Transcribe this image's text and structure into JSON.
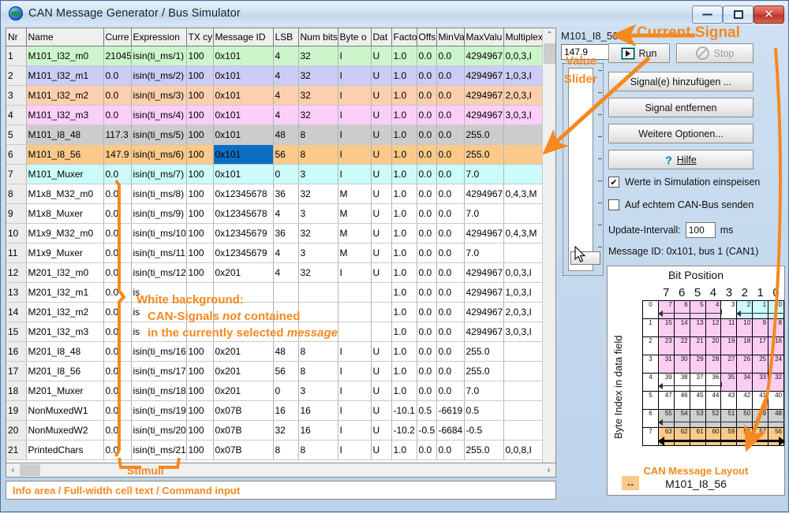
{
  "window": {
    "title": "CAN Message Generator / Bus Simulator",
    "icon": "globe-icon",
    "minimize_label": "–",
    "maximize_label": "□",
    "close_label": "✕"
  },
  "grid": {
    "columns": [
      "Nr",
      "Name",
      "Curre",
      "Expression",
      "TX cy",
      "Message ID",
      "LSB",
      "Num bits",
      "Byte o",
      "Dat",
      "Facto",
      "Offs",
      "MinVa",
      "MaxValu",
      "Multiplex"
    ],
    "selected_cell": {
      "row": 6,
      "column": "Message ID",
      "value": "0x101"
    },
    "rows": [
      {
        "nr": "1",
        "name": "M101_I32_m0",
        "cur": "21045",
        "expr": "isin(ti_ms/1)",
        "tx": "100",
        "msg": "0x101",
        "lsb": "4",
        "nbits": "32",
        "byteo": "I",
        "dt": "U",
        "factor": "1.0",
        "offset": "0.0",
        "minv": "0.0",
        "maxv": "4294967",
        "mux": "0,0,3,I",
        "color": "#ccf5cc"
      },
      {
        "nr": "2",
        "name": "M101_I32_m1",
        "cur": "0.0",
        "expr": "isin(ti_ms/2)",
        "tx": "100",
        "msg": "0x101",
        "lsb": "4",
        "nbits": "32",
        "byteo": "I",
        "dt": "U",
        "factor": "1.0",
        "offset": "0.0",
        "minv": "0.0",
        "maxv": "4294967",
        "mux": "1,0,3,I",
        "color": "#ccccf7"
      },
      {
        "nr": "3",
        "name": "M101_I32_m2",
        "cur": "0.0",
        "expr": "isin(ti_ms/3)",
        "tx": "100",
        "msg": "0x101",
        "lsb": "4",
        "nbits": "32",
        "byteo": "I",
        "dt": "U",
        "factor": "1.0",
        "offset": "0.0",
        "minv": "0.0",
        "maxv": "4294967",
        "mux": "2,0,3,I",
        "color": "#fccfae"
      },
      {
        "nr": "4",
        "name": "M101_I32_m3",
        "cur": "0.0",
        "expr": "isin(ti_ms/4)",
        "tx": "100",
        "msg": "0x101",
        "lsb": "4",
        "nbits": "32",
        "byteo": "I",
        "dt": "U",
        "factor": "1.0",
        "offset": "0.0",
        "minv": "0.0",
        "maxv": "4294967",
        "mux": "3,0,3,I",
        "color": "#fccffb"
      },
      {
        "nr": "5",
        "name": "M101_I8_48",
        "cur": "117.3",
        "expr": "isin(ti_ms/5)",
        "tx": "100",
        "msg": "0x101",
        "lsb": "48",
        "nbits": "8",
        "byteo": "I",
        "dt": "U",
        "factor": "1.0",
        "offset": "0.0",
        "minv": "0.0",
        "maxv": "255.0",
        "mux": "",
        "color": "#cccccc"
      },
      {
        "nr": "6",
        "name": "M101_I8_56",
        "cur": "147.9",
        "expr": "isin(ti_ms/6)",
        "tx": "100",
        "msg": "0x101",
        "lsb": "56",
        "nbits": "8",
        "byteo": "I",
        "dt": "U",
        "factor": "1.0",
        "offset": "0.0",
        "minv": "0.0",
        "maxv": "255.0",
        "mux": "",
        "color": "#fbca8a"
      },
      {
        "nr": "7",
        "name": "M101_Muxer",
        "cur": "0.0",
        "expr": "isin(ti_ms/7)",
        "tx": "100",
        "msg": "0x101",
        "lsb": "0",
        "nbits": "3",
        "byteo": "I",
        "dt": "U",
        "factor": "1.0",
        "offset": "0.0",
        "minv": "0.0",
        "maxv": "7.0",
        "mux": "",
        "color": "#ccfbfb"
      },
      {
        "nr": "8",
        "name": "M1x8_M32_m0",
        "cur": "0.0",
        "expr": "isin(ti_ms/8)",
        "tx": "100",
        "msg": "0x12345678",
        "lsb": "36",
        "nbits": "32",
        "byteo": "M",
        "dt": "U",
        "factor": "1.0",
        "offset": "0.0",
        "minv": "0.0",
        "maxv": "4294967",
        "mux": "0,4,3,M",
        "color": "#ffffff"
      },
      {
        "nr": "9",
        "name": "M1x8_Muxer",
        "cur": "0.0",
        "expr": "isin(ti_ms/9)",
        "tx": "100",
        "msg": "0x12345678",
        "lsb": "4",
        "nbits": "3",
        "byteo": "M",
        "dt": "U",
        "factor": "1.0",
        "offset": "0.0",
        "minv": "0.0",
        "maxv": "7.0",
        "mux": "",
        "color": "#ffffff"
      },
      {
        "nr": "10",
        "name": "M1x9_M32_m0",
        "cur": "0.0",
        "expr": "isin(ti_ms/10",
        "tx": "100",
        "msg": "0x12345679",
        "lsb": "36",
        "nbits": "32",
        "byteo": "M",
        "dt": "U",
        "factor": "1.0",
        "offset": "0.0",
        "minv": "0.0",
        "maxv": "4294967",
        "mux": "0,4,3,M",
        "color": "#ffffff"
      },
      {
        "nr": "11",
        "name": "M1x9_Muxer",
        "cur": "0.0",
        "expr": "isin(ti_ms/11",
        "tx": "100",
        "msg": "0x12345679",
        "lsb": "4",
        "nbits": "3",
        "byteo": "M",
        "dt": "U",
        "factor": "1.0",
        "offset": "0.0",
        "minv": "0.0",
        "maxv": "7.0",
        "mux": "",
        "color": "#ffffff"
      },
      {
        "nr": "12",
        "name": "M201_I32_m0",
        "cur": "0.0",
        "expr": "isin(ti_ms/12",
        "tx": "100",
        "msg": "0x201",
        "lsb": "4",
        "nbits": "32",
        "byteo": "I",
        "dt": "U",
        "factor": "1.0",
        "offset": "0.0",
        "minv": "0.0",
        "maxv": "4294967",
        "mux": "0,0,3,I",
        "color": "#ffffff"
      },
      {
        "nr": "13",
        "name": "M201_I32_m1",
        "cur": "0.0",
        "expr": "is",
        "tx": "",
        "msg": "",
        "lsb": "",
        "nbits": "",
        "byteo": "",
        "dt": "",
        "factor": "1.0",
        "offset": "0.0",
        "minv": "0.0",
        "maxv": "4294967",
        "mux": "1,0,3,I",
        "color": "#ffffff"
      },
      {
        "nr": "14",
        "name": "M201_I32_m2",
        "cur": "0.0",
        "expr": "is",
        "tx": "",
        "msg": "",
        "lsb": "",
        "nbits": "",
        "byteo": "",
        "dt": "",
        "factor": "1.0",
        "offset": "0.0",
        "minv": "0.0",
        "maxv": "4294967",
        "mux": "2,0,3,I",
        "color": "#ffffff"
      },
      {
        "nr": "15",
        "name": "M201_I32_m3",
        "cur": "0.0",
        "expr": "is",
        "tx": "",
        "msg": "",
        "lsb": "",
        "nbits": "",
        "byteo": "",
        "dt": "",
        "factor": "1.0",
        "offset": "0.0",
        "minv": "0.0",
        "maxv": "4294967",
        "mux": "3,0,3,I",
        "color": "#ffffff"
      },
      {
        "nr": "16",
        "name": "M201_I8_48",
        "cur": "0.0",
        "expr": "isin(ti_ms/16",
        "tx": "100",
        "msg": "0x201",
        "lsb": "48",
        "nbits": "8",
        "byteo": "I",
        "dt": "U",
        "factor": "1.0",
        "offset": "0.0",
        "minv": "0.0",
        "maxv": "255.0",
        "mux": "",
        "color": "#ffffff"
      },
      {
        "nr": "17",
        "name": "M201_I8_56",
        "cur": "0.0",
        "expr": "isin(ti_ms/17",
        "tx": "100",
        "msg": "0x201",
        "lsb": "56",
        "nbits": "8",
        "byteo": "I",
        "dt": "U",
        "factor": "1.0",
        "offset": "0.0",
        "minv": "0.0",
        "maxv": "255.0",
        "mux": "",
        "color": "#ffffff"
      },
      {
        "nr": "18",
        "name": "M201_Muxer",
        "cur": "0.0",
        "expr": "isin(ti_ms/18",
        "tx": "100",
        "msg": "0x201",
        "lsb": "0",
        "nbits": "3",
        "byteo": "I",
        "dt": "U",
        "factor": "1.0",
        "offset": "0.0",
        "minv": "0.0",
        "maxv": "7.0",
        "mux": "",
        "color": "#ffffff"
      },
      {
        "nr": "19",
        "name": "NonMuxedW1",
        "cur": "0.0",
        "expr": "isin(ti_ms/19",
        "tx": "100",
        "msg": "0x07B",
        "lsb": "16",
        "nbits": "16",
        "byteo": "I",
        "dt": "U",
        "factor": "-10.1",
        "offset": "0.5",
        "minv": "-6619",
        "maxv": "0.5",
        "mux": "",
        "color": "#ffffff"
      },
      {
        "nr": "20",
        "name": "NonMuxedW2",
        "cur": "0.0",
        "expr": "isin(ti_ms/20",
        "tx": "100",
        "msg": "0x07B",
        "lsb": "32",
        "nbits": "16",
        "byteo": "I",
        "dt": "U",
        "factor": "-10.2",
        "offset": "-0.5",
        "minv": "-6684",
        "maxv": "-0.5",
        "mux": "",
        "color": "#ffffff"
      },
      {
        "nr": "21",
        "name": "PrintedChars",
        "cur": "0.0",
        "expr": "isin(ti_ms/21",
        "tx": "100",
        "msg": "0x07B",
        "lsb": "8",
        "nbits": "8",
        "byteo": "I",
        "dt": "U",
        "factor": "1.0",
        "offset": "0.0",
        "minv": "0.0",
        "maxv": "255.0",
        "mux": "0,0,8,I",
        "color": "#ffffff"
      }
    ]
  },
  "infobar": {
    "text": "Info area / Full-width cell text / Command input"
  },
  "scrollbars": {
    "up_arrow": "⌃",
    "down_arrow": "⌄",
    "left_arrow": "‹",
    "right_arrow": "›"
  },
  "panel": {
    "signal_name": "M101_I8_56",
    "value": "147.9",
    "run_label": "Run",
    "stop_label": "Stop",
    "add_signal_label": "Signal(e) hinzufügen ...",
    "remove_signal_label": "Signal entfernen",
    "more_options_label": "Weitere Optionen...",
    "help_label": "Hilfe",
    "help_icon": "question-mark-icon",
    "checkbox_feed_label": "Werte in Simulation einspeisen",
    "checkbox_feed_checked": "✔",
    "checkbox_canbus_label": "Auf echtem CAN-Bus senden",
    "update_interval_label": "Update-Intervall:",
    "update_interval_value": "100",
    "update_interval_unit": "ms",
    "message_id_info": "Message ID: 0x101, bus 1 (CAN1)"
  },
  "bitlayout": {
    "title": "Bit Position",
    "y_axis_label": "Byte Index in data field",
    "bit_headers": [
      "7",
      "6",
      "5",
      "4",
      "3",
      "2",
      "1",
      "0"
    ],
    "row_labels": [
      "0",
      "1",
      "2",
      "3",
      "4",
      "5",
      "6",
      "7"
    ],
    "cells": [
      [
        {
          "n": "7",
          "c": "pink"
        },
        {
          "n": "6",
          "c": "pink"
        },
        {
          "n": "5",
          "c": "pink"
        },
        {
          "n": "4",
          "c": "pink"
        },
        {
          "n": "3",
          "c": "white"
        },
        {
          "n": "2",
          "c": "cyan"
        },
        {
          "n": "1",
          "c": "cyan"
        },
        {
          "n": "0",
          "c": "cyan"
        }
      ],
      [
        {
          "n": "15",
          "c": "pink"
        },
        {
          "n": "14",
          "c": "pink"
        },
        {
          "n": "13",
          "c": "pink"
        },
        {
          "n": "12",
          "c": "pink"
        },
        {
          "n": "11",
          "c": "pink"
        },
        {
          "n": "10",
          "c": "pink"
        },
        {
          "n": "9",
          "c": "pink"
        },
        {
          "n": "8",
          "c": "pink"
        }
      ],
      [
        {
          "n": "23",
          "c": "pink"
        },
        {
          "n": "22",
          "c": "pink"
        },
        {
          "n": "21",
          "c": "pink"
        },
        {
          "n": "20",
          "c": "pink"
        },
        {
          "n": "19",
          "c": "pink"
        },
        {
          "n": "18",
          "c": "pink"
        },
        {
          "n": "17",
          "c": "pink"
        },
        {
          "n": "16",
          "c": "pink"
        }
      ],
      [
        {
          "n": "31",
          "c": "pink"
        },
        {
          "n": "30",
          "c": "pink"
        },
        {
          "n": "29",
          "c": "pink"
        },
        {
          "n": "28",
          "c": "pink"
        },
        {
          "n": "27",
          "c": "pink"
        },
        {
          "n": "26",
          "c": "pink"
        },
        {
          "n": "25",
          "c": "pink"
        },
        {
          "n": "24",
          "c": "pink"
        }
      ],
      [
        {
          "n": "39",
          "c": "white"
        },
        {
          "n": "38",
          "c": "white"
        },
        {
          "n": "37",
          "c": "white"
        },
        {
          "n": "36",
          "c": "white"
        },
        {
          "n": "35",
          "c": "pink"
        },
        {
          "n": "34",
          "c": "pink"
        },
        {
          "n": "33",
          "c": "pink"
        },
        {
          "n": "32",
          "c": "pink"
        }
      ],
      [
        {
          "n": "47",
          "c": "white"
        },
        {
          "n": "46",
          "c": "white"
        },
        {
          "n": "45",
          "c": "white"
        },
        {
          "n": "44",
          "c": "white"
        },
        {
          "n": "43",
          "c": "white"
        },
        {
          "n": "42",
          "c": "white"
        },
        {
          "n": "41",
          "c": "white"
        },
        {
          "n": "40",
          "c": "white"
        }
      ],
      [
        {
          "n": "55",
          "c": "gray"
        },
        {
          "n": "54",
          "c": "gray"
        },
        {
          "n": "53",
          "c": "gray"
        },
        {
          "n": "52",
          "c": "gray"
        },
        {
          "n": "51",
          "c": "gray"
        },
        {
          "n": "50",
          "c": "gray"
        },
        {
          "n": "49",
          "c": "gray"
        },
        {
          "n": "48",
          "c": "gray"
        }
      ],
      [
        {
          "n": "63",
          "c": "orange"
        },
        {
          "n": "62",
          "c": "orange"
        },
        {
          "n": "61",
          "c": "orange"
        },
        {
          "n": "60",
          "c": "orange"
        },
        {
          "n": "59",
          "c": "orange"
        },
        {
          "n": "58",
          "c": "orange"
        },
        {
          "n": "57",
          "c": "orange"
        },
        {
          "n": "56",
          "c": "orange"
        }
      ]
    ],
    "footer_title": "CAN Message Layout",
    "footer_signal": "M101_I8_56",
    "footer_swatch_glyph": "↔"
  },
  "annotations": {
    "current_signal": "Current Signal",
    "value": "Value",
    "slider": "Slider",
    "stimuli": "Stimuli",
    "white_bg_l1": "White background:",
    "white_bg_l2a": "CAN-Signals ",
    "white_bg_l2b": "not",
    "white_bg_l2c": " contained",
    "white_bg_l3a": "in the currently selected ",
    "white_bg_l3b": "message",
    "color": "#f5881f"
  }
}
